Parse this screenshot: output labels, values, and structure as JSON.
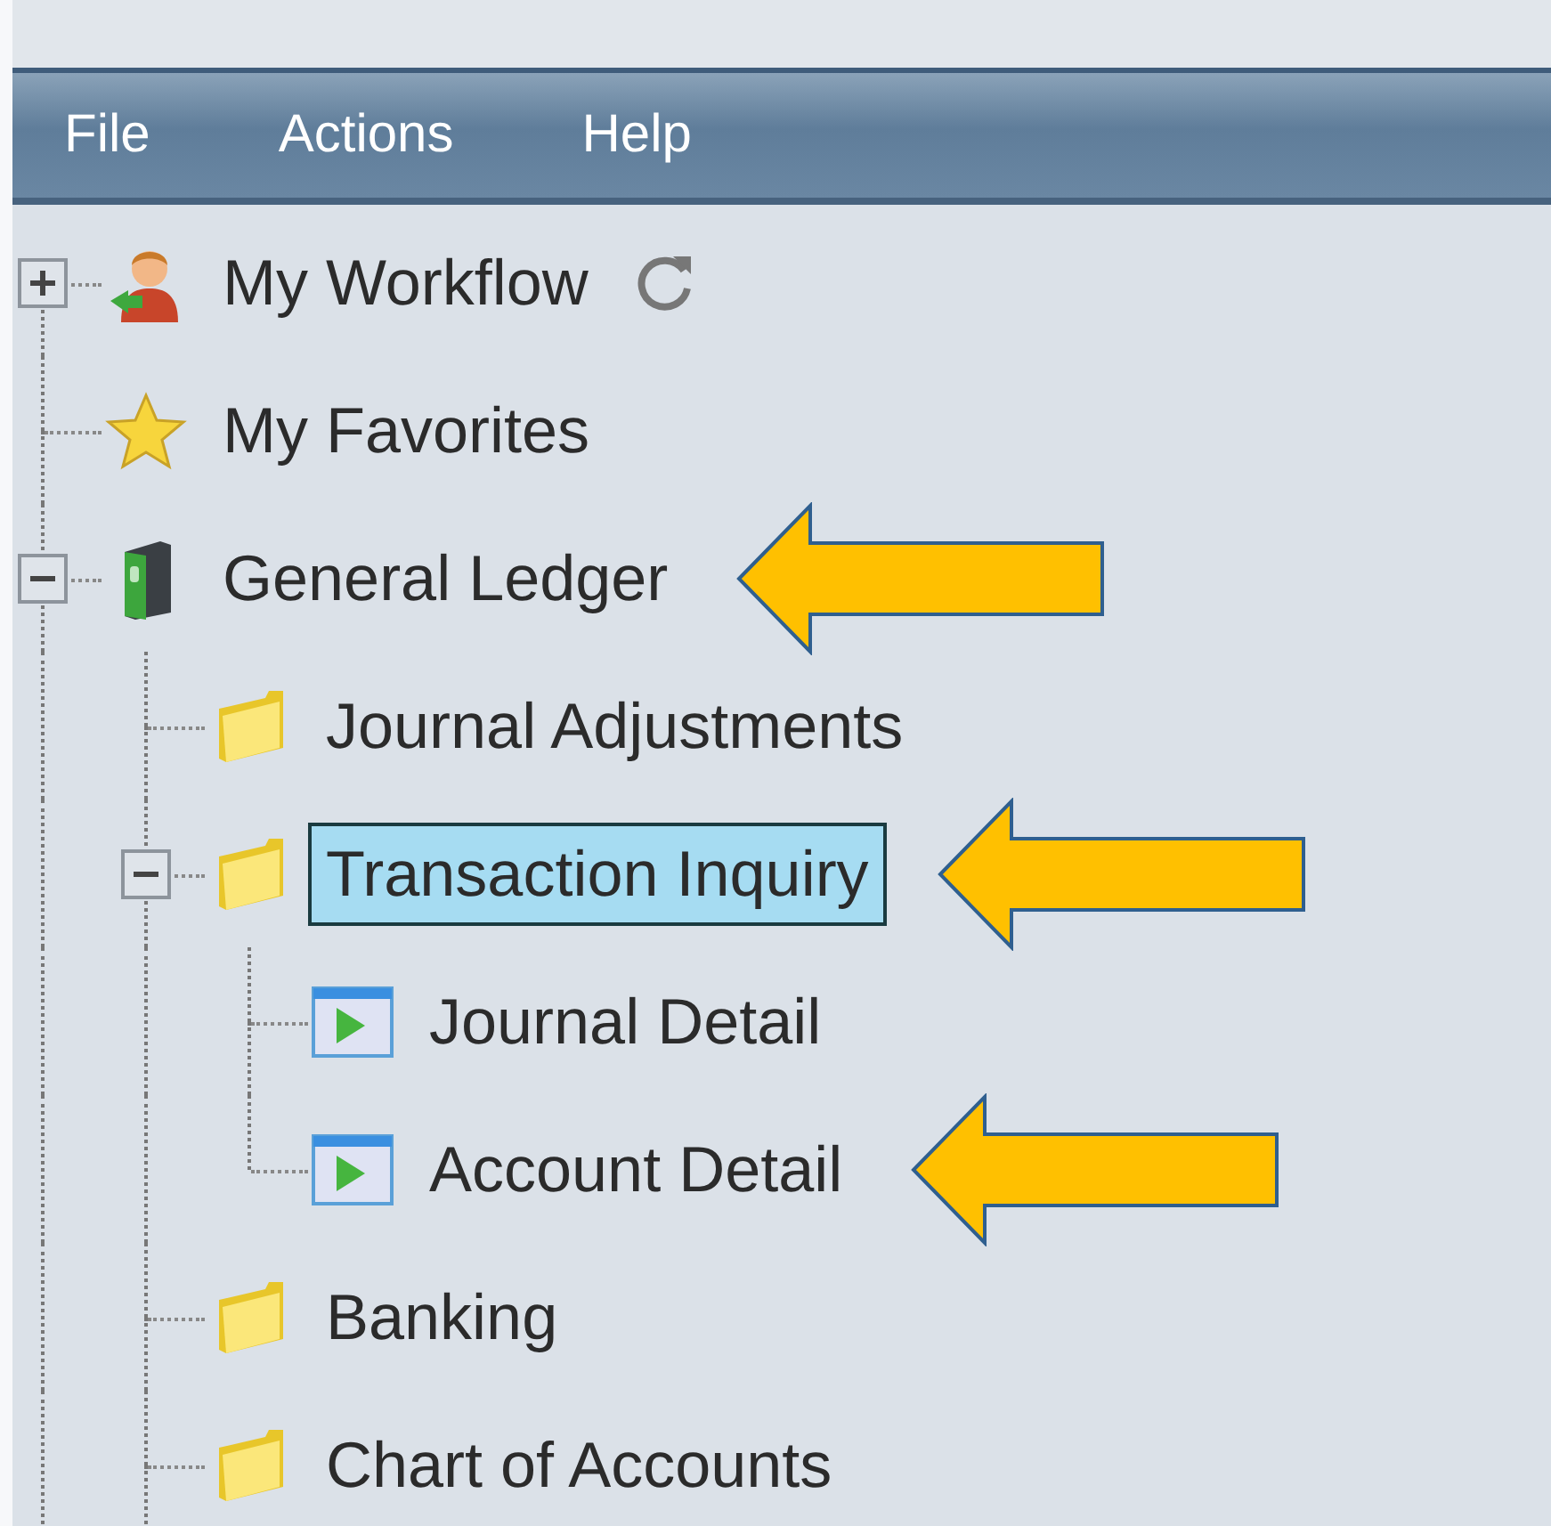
{
  "menu_bar": {
    "items": [
      "File",
      "Actions",
      "Help"
    ]
  },
  "tree": {
    "continues_below": true,
    "items": [
      {
        "label": "My Workflow",
        "kind": "user",
        "expanded": false,
        "selected": false,
        "refresh": true
      },
      {
        "label": "My Favorites",
        "kind": "star",
        "selected": false
      },
      {
        "label": "General Ledger",
        "kind": "binder",
        "expanded": true,
        "selected": false,
        "annotated": true,
        "children": [
          {
            "label": "Journal Adjustments",
            "kind": "folder",
            "selected": false
          },
          {
            "label": "Transaction Inquiry",
            "kind": "folder",
            "expanded": true,
            "selected": true,
            "annotated": true,
            "children": [
              {
                "label": "Journal Detail",
                "kind": "report",
                "selected": false
              },
              {
                "label": "Account Detail",
                "kind": "report",
                "selected": false,
                "annotated": true
              }
            ]
          },
          {
            "label": "Banking",
            "kind": "folder",
            "selected": false
          },
          {
            "label": "Chart of Accounts",
            "kind": "folder",
            "selected": false
          }
        ]
      }
    ]
  }
}
